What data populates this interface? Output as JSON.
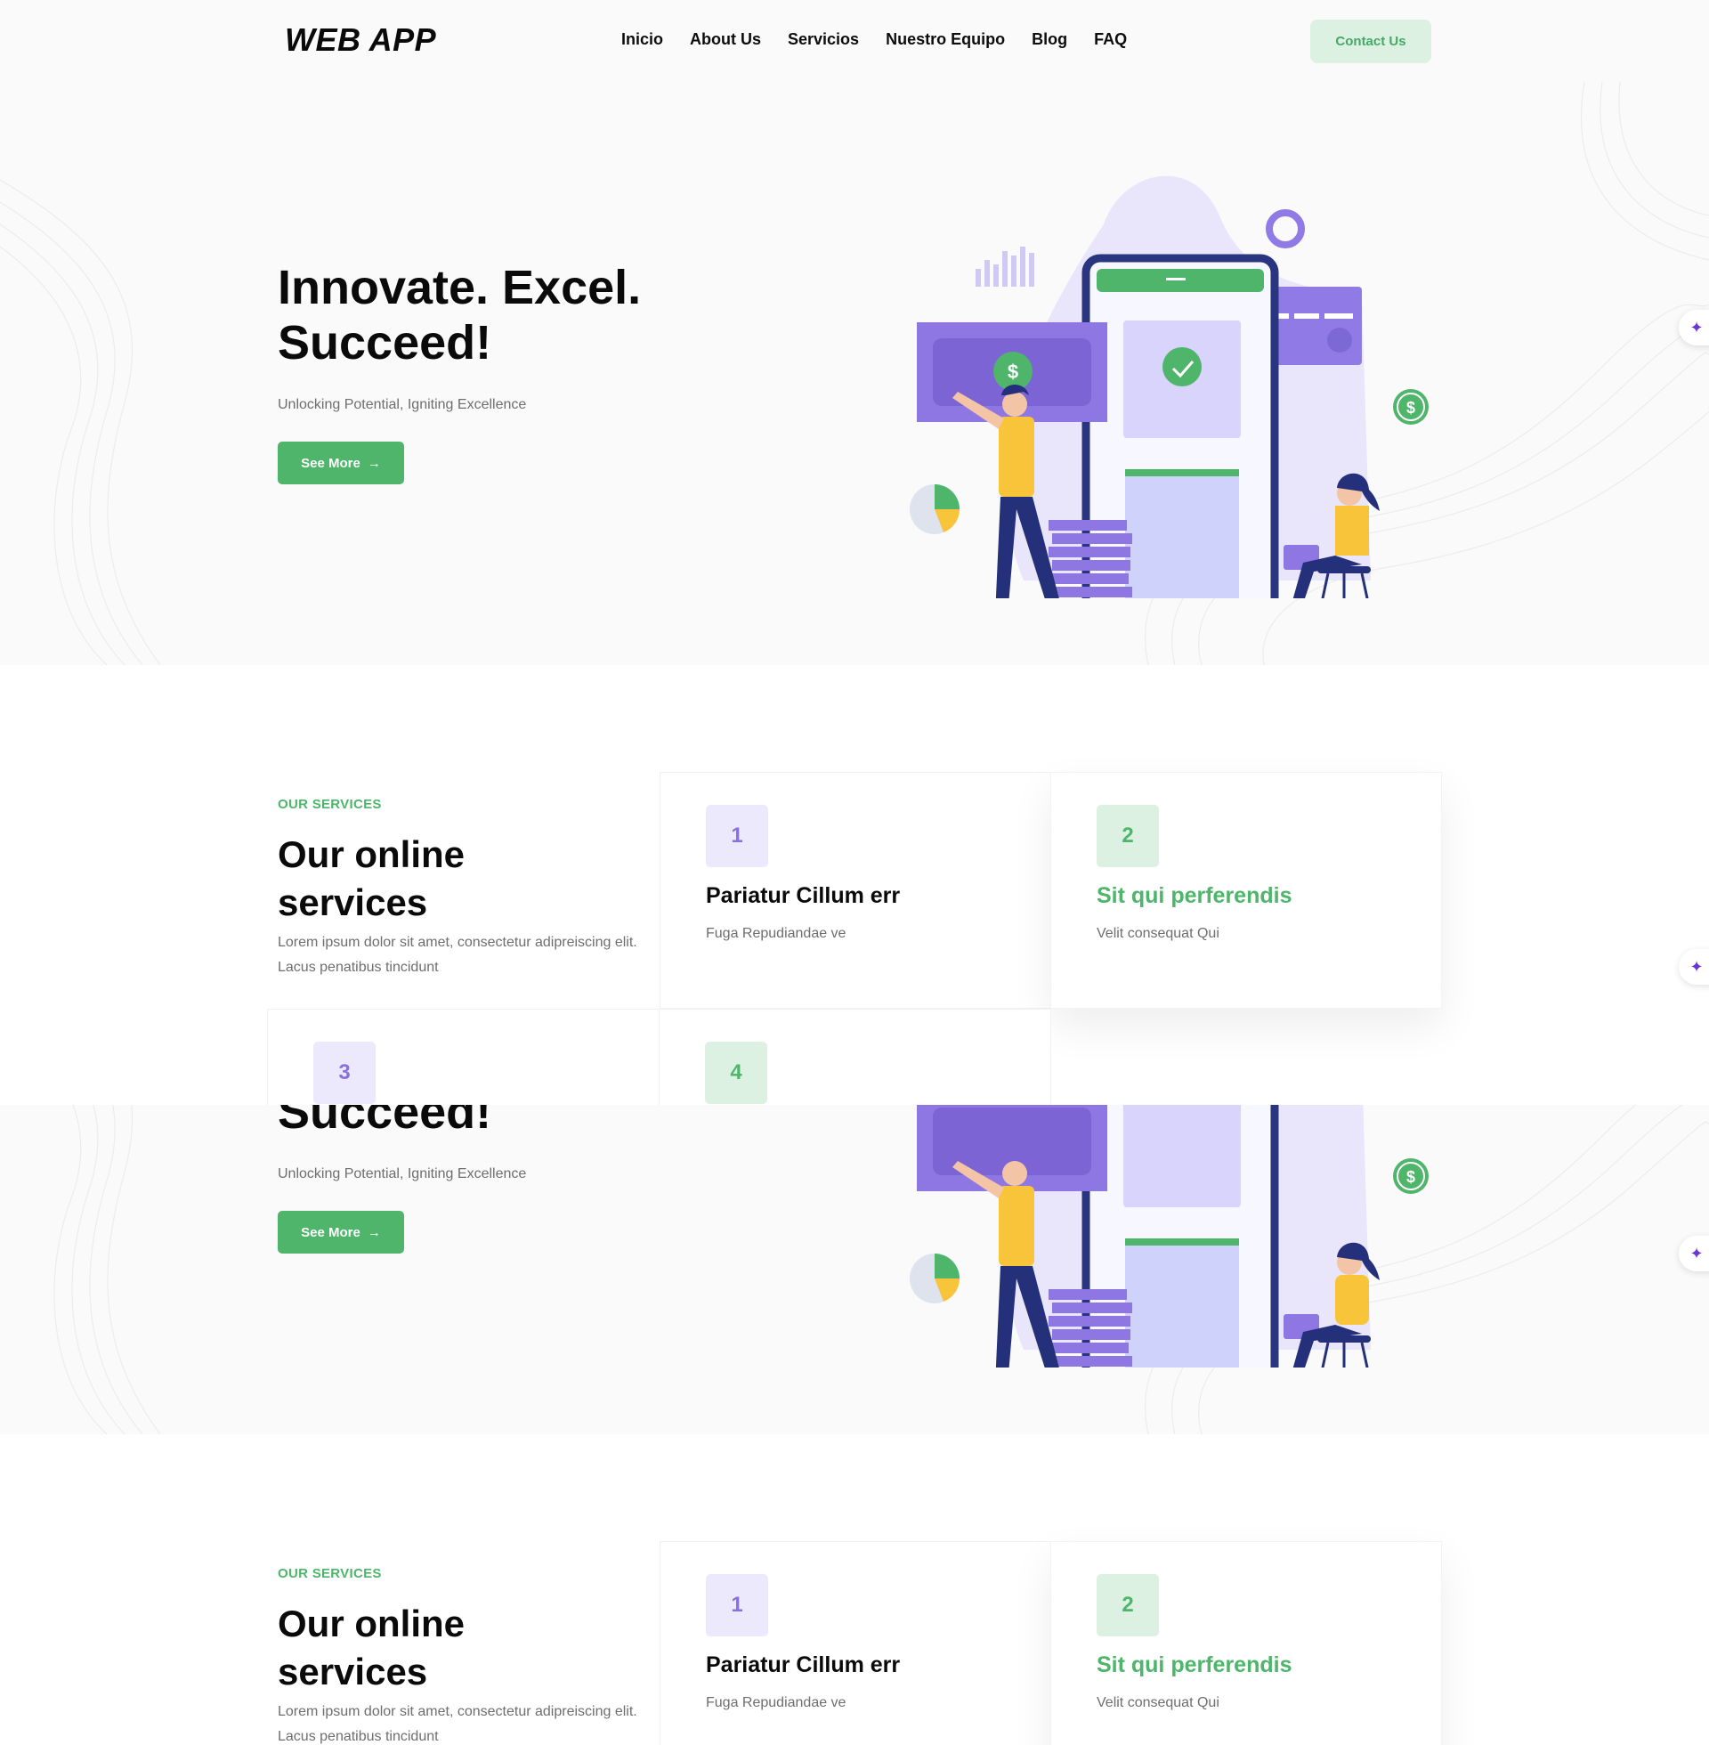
{
  "header": {
    "logo": "WEB APP",
    "nav": [
      "Inicio",
      "About Us",
      "Servicios",
      "Nuestro Equipo",
      "Blog",
      "FAQ"
    ],
    "contact_label": "Contact Us"
  },
  "hero": {
    "title": "Innovate. Excel. Succeed!",
    "subtitle": "Unlocking Potential, Igniting Excellence",
    "button_label": "See More",
    "button_icon": "arrow-right-icon"
  },
  "services": {
    "kicker": "OUR SERVICES",
    "title": "Our online services",
    "text": "Lorem ipsum dolor sit amet, consectetur adipreiscing elit. Lacus penatibus tincidunt",
    "cards": [
      {
        "number": "1",
        "title": "Pariatur Cillum err",
        "text": "Fuga Repudiandae ve"
      },
      {
        "number": "2",
        "title": "Sit qui perferendis",
        "text": "Velit consequat Qui"
      },
      {
        "number": "3",
        "title": "",
        "text": ""
      },
      {
        "number": "4",
        "title": "",
        "text": ""
      }
    ]
  },
  "colors": {
    "accent_green": "#4eb56b",
    "accent_purple": "#8870e0",
    "navy": "#24307a",
    "yellow": "#f8c43a"
  },
  "floating_button_icon": "sparkle-icon"
}
